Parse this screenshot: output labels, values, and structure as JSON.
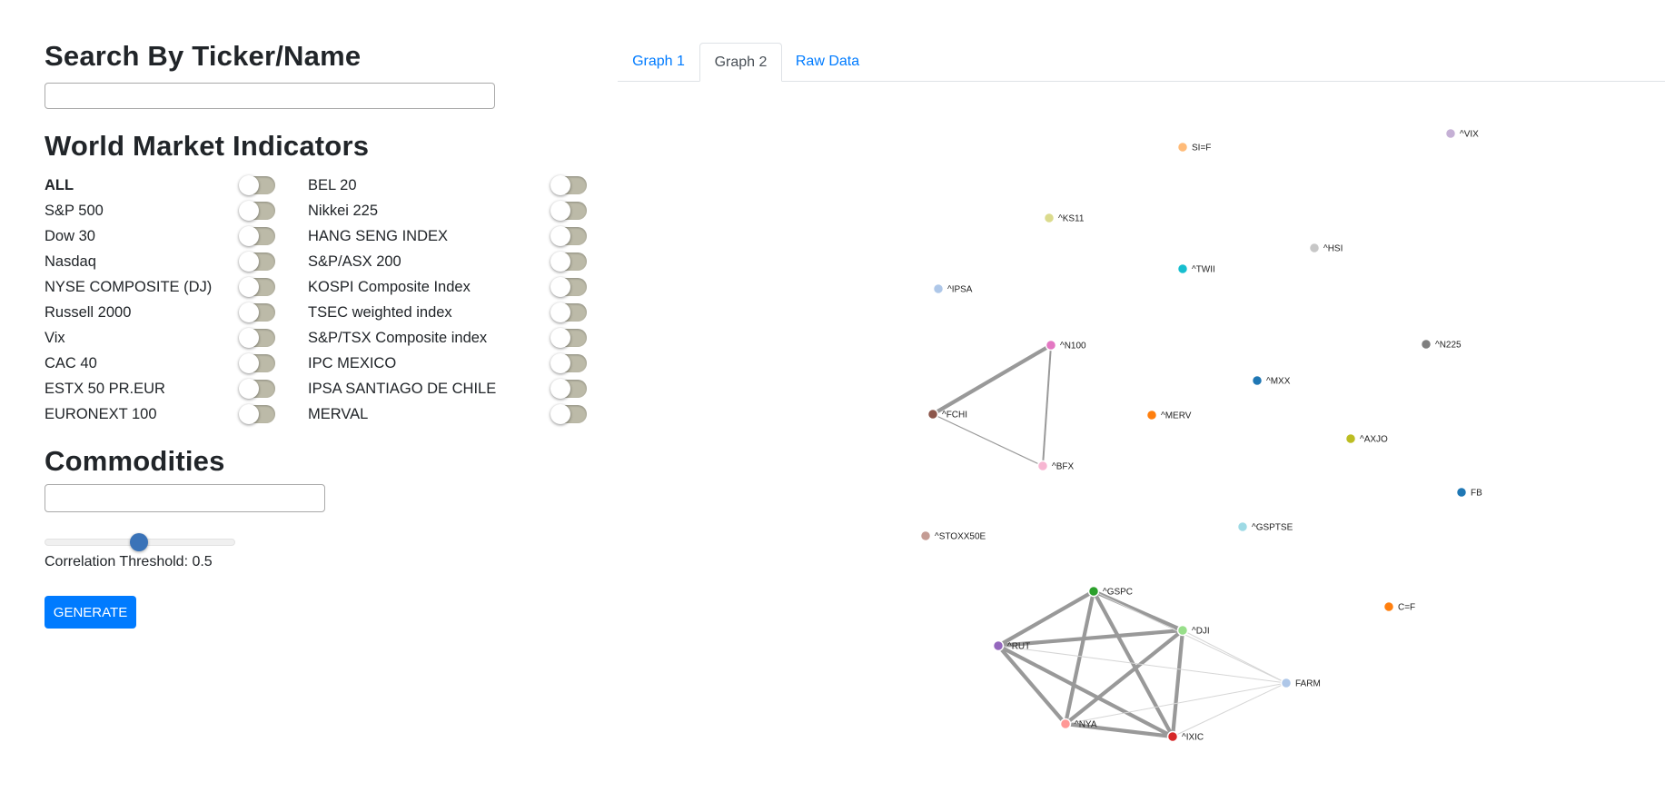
{
  "search": {
    "title": "Search By Ticker/Name",
    "value": ""
  },
  "indicators": {
    "title": "World Market Indicators",
    "col1": [
      "ALL",
      "S&P 500",
      "Dow 30",
      "Nasdaq",
      "NYSE COMPOSITE (DJ)",
      "Russell 2000",
      "Vix",
      "CAC 40",
      "ESTX 50 PR.EUR",
      "EURONEXT 100"
    ],
    "col2": [
      "BEL 20",
      "Nikkei 225",
      "HANG SENG INDEX",
      "S&P/ASX 200",
      "KOSPI Composite Index",
      "TSEC weighted index",
      "S&P/TSX Composite index",
      "IPC MEXICO",
      "IPSA SANTIAGO DE CHILE",
      "MERVAL"
    ]
  },
  "commodities": {
    "title": "Commodities",
    "value": ""
  },
  "threshold": {
    "label": "Correlation Threshold: 0.5",
    "value": 0.5
  },
  "generate_label": "GENERATE",
  "tabs": [
    {
      "label": "Graph 1",
      "active": false
    },
    {
      "label": "Graph 2",
      "active": true
    },
    {
      "label": "Raw Data",
      "active": false
    }
  ],
  "graph": {
    "nodes": [
      {
        "id": "^VIX",
        "color": "#c5b0d5"
      },
      {
        "id": "SI=F",
        "color": "#ffbb78"
      },
      {
        "id": "^KS11",
        "color": "#dbdb8d"
      },
      {
        "id": "^HSI",
        "color": "#c7c7c7"
      },
      {
        "id": "^TWII",
        "color": "#17becf"
      },
      {
        "id": "^IPSA",
        "color": "#aec7e8"
      },
      {
        "id": "^N100",
        "color": "#e377c2"
      },
      {
        "id": "^N225",
        "color": "#7f7f7f"
      },
      {
        "id": "^MXX",
        "color": "#1f77b4"
      },
      {
        "id": "^FCHI",
        "color": "#8c564b"
      },
      {
        "id": "^MERV",
        "color": "#ff7f0e"
      },
      {
        "id": "^AXJO",
        "color": "#bcbd22"
      },
      {
        "id": "^BFX",
        "color": "#f7b6d2"
      },
      {
        "id": "FB",
        "color": "#1f77b4"
      },
      {
        "id": "^GSPTSE",
        "color": "#9edae5"
      },
      {
        "id": "^STOXX50E",
        "color": "#c49c94"
      },
      {
        "id": "^GSPC",
        "color": "#2ca02c"
      },
      {
        "id": "C=F",
        "color": "#ff7f0e"
      },
      {
        "id": "^DJI",
        "color": "#98df8a"
      },
      {
        "id": "^RUT",
        "color": "#9467bd"
      },
      {
        "id": "FARM",
        "color": "#aec7e8"
      },
      {
        "id": "^NYA",
        "color": "#ff9896"
      },
      {
        "id": "^IXIC",
        "color": "#d62728"
      }
    ],
    "links": [
      {
        "source": "^N100",
        "target": "^FCHI",
        "strength": "strong"
      },
      {
        "source": "^N100",
        "target": "^BFX",
        "strength": "medium"
      },
      {
        "source": "^FCHI",
        "target": "^BFX",
        "strength": "weak"
      },
      {
        "source": "^GSPC",
        "target": "^DJI",
        "strength": "strong"
      },
      {
        "source": "^GSPC",
        "target": "^RUT",
        "strength": "strong"
      },
      {
        "source": "^GSPC",
        "target": "^NYA",
        "strength": "strong"
      },
      {
        "source": "^GSPC",
        "target": "^IXIC",
        "strength": "strong"
      },
      {
        "source": "^DJI",
        "target": "^RUT",
        "strength": "strong"
      },
      {
        "source": "^DJI",
        "target": "^NYA",
        "strength": "strong"
      },
      {
        "source": "^DJI",
        "target": "^IXIC",
        "strength": "strong"
      },
      {
        "source": "^RUT",
        "target": "^NYA",
        "strength": "strong"
      },
      {
        "source": "^RUT",
        "target": "^IXIC",
        "strength": "strong"
      },
      {
        "source": "^NYA",
        "target": "^IXIC",
        "strength": "strong"
      },
      {
        "source": "^RUT",
        "target": "FARM",
        "strength": "faint"
      },
      {
        "source": "^DJI",
        "target": "FARM",
        "strength": "faint"
      },
      {
        "source": "^GSPC",
        "target": "FARM",
        "strength": "faint"
      },
      {
        "source": "^NYA",
        "target": "FARM",
        "strength": "faint"
      },
      {
        "source": "^IXIC",
        "target": "FARM",
        "strength": "faint"
      }
    ]
  }
}
